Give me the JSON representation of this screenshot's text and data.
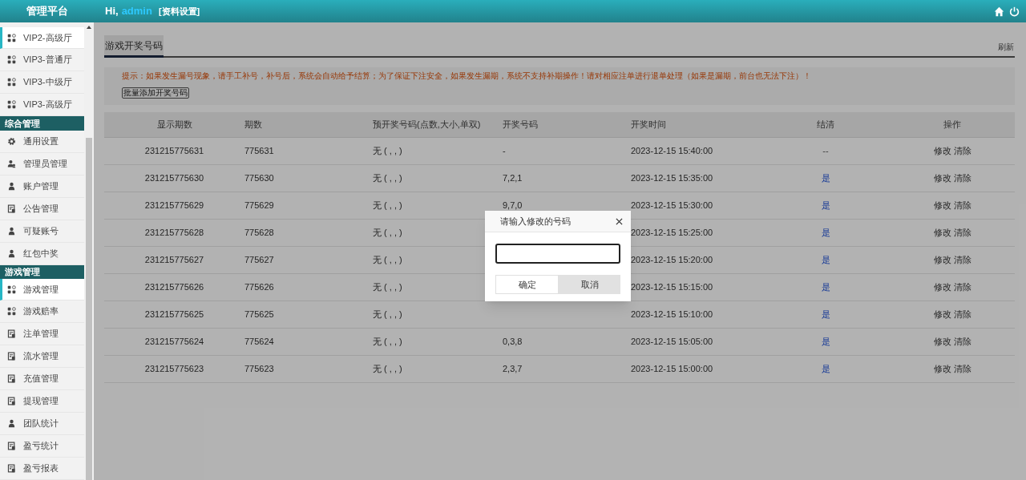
{
  "header": {
    "brand": "管理平台",
    "greeting": "Hi,",
    "user": "admin",
    "profile_link": "[资料设置]"
  },
  "sidebar": {
    "groups": [
      {
        "items": [
          {
            "label": "VIP2-高级厅",
            "kind": "grid",
            "selected": true
          },
          {
            "label": "VIP3-普通厅",
            "kind": "grid",
            "selected": false
          },
          {
            "label": "VIP3-中级厅",
            "kind": "grid",
            "selected": false
          },
          {
            "label": "VIP3-高级厅",
            "kind": "grid",
            "selected": false
          }
        ]
      },
      {
        "title": "综合管理",
        "items": [
          {
            "label": "通用设置",
            "kind": "gear",
            "selected": false
          },
          {
            "label": "管理员管理",
            "kind": "users",
            "selected": false
          },
          {
            "label": "账户管理",
            "kind": "user",
            "selected": false
          },
          {
            "label": "公告管理",
            "kind": "doc",
            "selected": false
          },
          {
            "label": "可疑账号",
            "kind": "user",
            "selected": false
          },
          {
            "label": "红包中奖",
            "kind": "user",
            "selected": false
          }
        ]
      },
      {
        "title": "游戏管理",
        "items": [
          {
            "label": "游戏管理",
            "kind": "grid",
            "selected": true
          },
          {
            "label": "游戏赔率",
            "kind": "grid",
            "selected": false
          },
          {
            "label": "注单管理",
            "kind": "doc",
            "selected": false
          },
          {
            "label": "流水管理",
            "kind": "doc",
            "selected": false
          },
          {
            "label": "充值管理",
            "kind": "doc",
            "selected": false
          },
          {
            "label": "提现管理",
            "kind": "doc",
            "selected": false
          },
          {
            "label": "团队统计",
            "kind": "user",
            "selected": false
          },
          {
            "label": "盈亏统计",
            "kind": "doc",
            "selected": false
          },
          {
            "label": "盈亏报表",
            "kind": "doc",
            "selected": false
          }
        ]
      }
    ]
  },
  "page": {
    "tab": "游戏开奖号码",
    "refresh": "刷新",
    "notice": "提示：如果发生漏号现象，请手工补号，补号后，系统会自动给予结算；为了保证下注安全，如果发生漏期，系统不支持补期操作！请对相应注单进行退单处理（如果是漏期，前台也无法下注）！",
    "batch_button": "批量添加开奖号码"
  },
  "table": {
    "columns": [
      "显示期数",
      "期数",
      "预开奖号码(点数,大小,单双)",
      "开奖号码",
      "开奖时间",
      "结清",
      "操作"
    ],
    "rows": [
      {
        "display_issue": "231215775631",
        "issue": "775631",
        "preset": "无 ( , , )",
        "result": "-",
        "time": "2023-12-15 15:40:00",
        "settled": false,
        "settle_text": "--",
        "actions": [
          "修改",
          "清除"
        ]
      },
      {
        "display_issue": "231215775630",
        "issue": "775630",
        "preset": "无 ( , , )",
        "result": "7,2,1",
        "time": "2023-12-15 15:35:00",
        "settled": true,
        "settle_text": "是",
        "actions": [
          "修改",
          "清除"
        ]
      },
      {
        "display_issue": "231215775629",
        "issue": "775629",
        "preset": "无 ( , , )",
        "result": "9,7,0",
        "time": "2023-12-15 15:30:00",
        "settled": true,
        "settle_text": "是",
        "actions": [
          "修改",
          "清除"
        ]
      },
      {
        "display_issue": "231215775628",
        "issue": "775628",
        "preset": "无 ( , , )",
        "time": "2023-12-15 15:25:00",
        "settled": true,
        "settle_text": "是",
        "actions": [
          "修改",
          "清除"
        ]
      },
      {
        "display_issue": "231215775627",
        "issue": "775627",
        "preset": "无 ( , , )",
        "time": "2023-12-15 15:20:00",
        "settled": true,
        "settle_text": "是",
        "actions": [
          "修改",
          "清除"
        ]
      },
      {
        "display_issue": "231215775626",
        "issue": "775626",
        "preset": "无 ( , , )",
        "time": "2023-12-15 15:15:00",
        "settled": true,
        "settle_text": "是",
        "actions": [
          "修改",
          "清除"
        ]
      },
      {
        "display_issue": "231215775625",
        "issue": "775625",
        "preset": "无 ( , , )",
        "time": "2023-12-15 15:10:00",
        "settled": true,
        "settle_text": "是",
        "actions": [
          "修改",
          "清除"
        ]
      },
      {
        "display_issue": "231215775624",
        "issue": "775624",
        "preset": "无 ( , , )",
        "result": "0,3,8",
        "time": "2023-12-15 15:05:00",
        "settled": true,
        "settle_text": "是",
        "actions": [
          "修改",
          "清除"
        ]
      },
      {
        "display_issue": "231215775623",
        "issue": "775623",
        "preset": "无 ( , , )",
        "result": "2,3,7",
        "time": "2023-12-15 15:00:00",
        "settled": true,
        "settle_text": "是",
        "actions": [
          "修改",
          "清除"
        ]
      }
    ]
  },
  "dialog": {
    "title": "请输入修改的号码",
    "buttons": [
      "确定",
      "取消"
    ]
  }
}
